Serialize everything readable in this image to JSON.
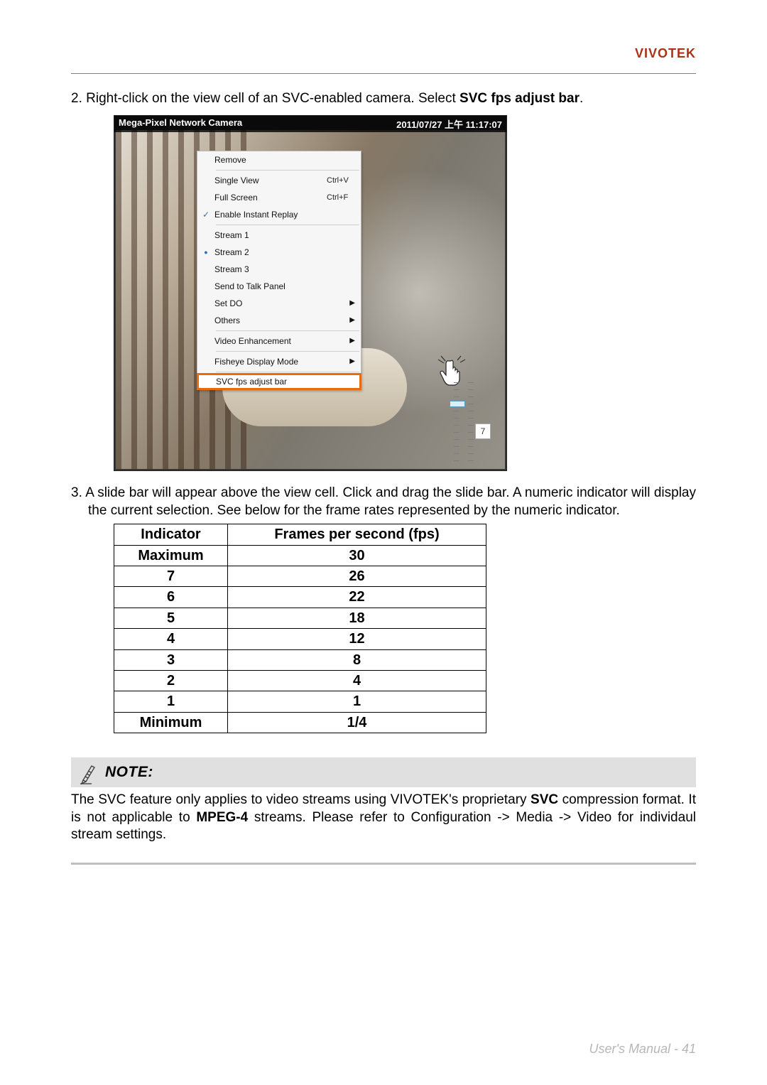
{
  "brand": "VIVOTEK",
  "step2": {
    "prefix": "2. Right-click on the view cell of an SVC-enabled camera. Select ",
    "bold": "SVC fps adjust bar",
    "suffix": "."
  },
  "screenshot": {
    "title_left": "Mega-Pixel Network Camera",
    "title_right": "2011/07/27 上午 11:17:07",
    "menu": [
      {
        "label": "Remove"
      },
      {
        "sep": true
      },
      {
        "label": "Single View",
        "shortcut": "Ctrl+V"
      },
      {
        "label": "Full Screen",
        "shortcut": "Ctrl+F"
      },
      {
        "label": "Enable Instant Replay",
        "check": true
      },
      {
        "sep": true
      },
      {
        "label": "Stream 1"
      },
      {
        "label": "Stream 2",
        "radio": true
      },
      {
        "label": "Stream 3"
      },
      {
        "label": "Send to Talk Panel"
      },
      {
        "label": "Set DO",
        "arrow": true
      },
      {
        "label": "Others",
        "arrow": true
      },
      {
        "sep": true
      },
      {
        "label": "Video Enhancement",
        "arrow": true
      },
      {
        "sep": true
      },
      {
        "label": "Fisheye Display Mode",
        "arrow": true
      },
      {
        "sep": true
      },
      {
        "label": "SVC fps adjust bar",
        "highlight": true
      }
    ],
    "slider_value": "7"
  },
  "step3": "3. A slide bar will appear above the view cell. Click and drag the slide bar. A numeric indicator will display the current selection. See below for the frame rates represented by the numeric indicator.",
  "table": {
    "headers": [
      "Indicator",
      "Frames per second (fps)"
    ],
    "rows": [
      [
        "Maximum",
        "30"
      ],
      [
        "7",
        "26"
      ],
      [
        "6",
        "22"
      ],
      [
        "5",
        "18"
      ],
      [
        "4",
        "12"
      ],
      [
        "3",
        "8"
      ],
      [
        "2",
        "4"
      ],
      [
        "1",
        "1"
      ],
      [
        "Minimum",
        "1/4"
      ]
    ]
  },
  "note": {
    "heading": "NOTE:",
    "text_parts": [
      "The SVC feature only applies to video streams using VIVOTEK's proprietary ",
      "SVC",
      " compression format. It is not applicable to ",
      "MPEG-4",
      " streams. Please refer to Configuration -> Media -> Video for individaul stream settings."
    ]
  },
  "footer": "User's Manual - 41"
}
